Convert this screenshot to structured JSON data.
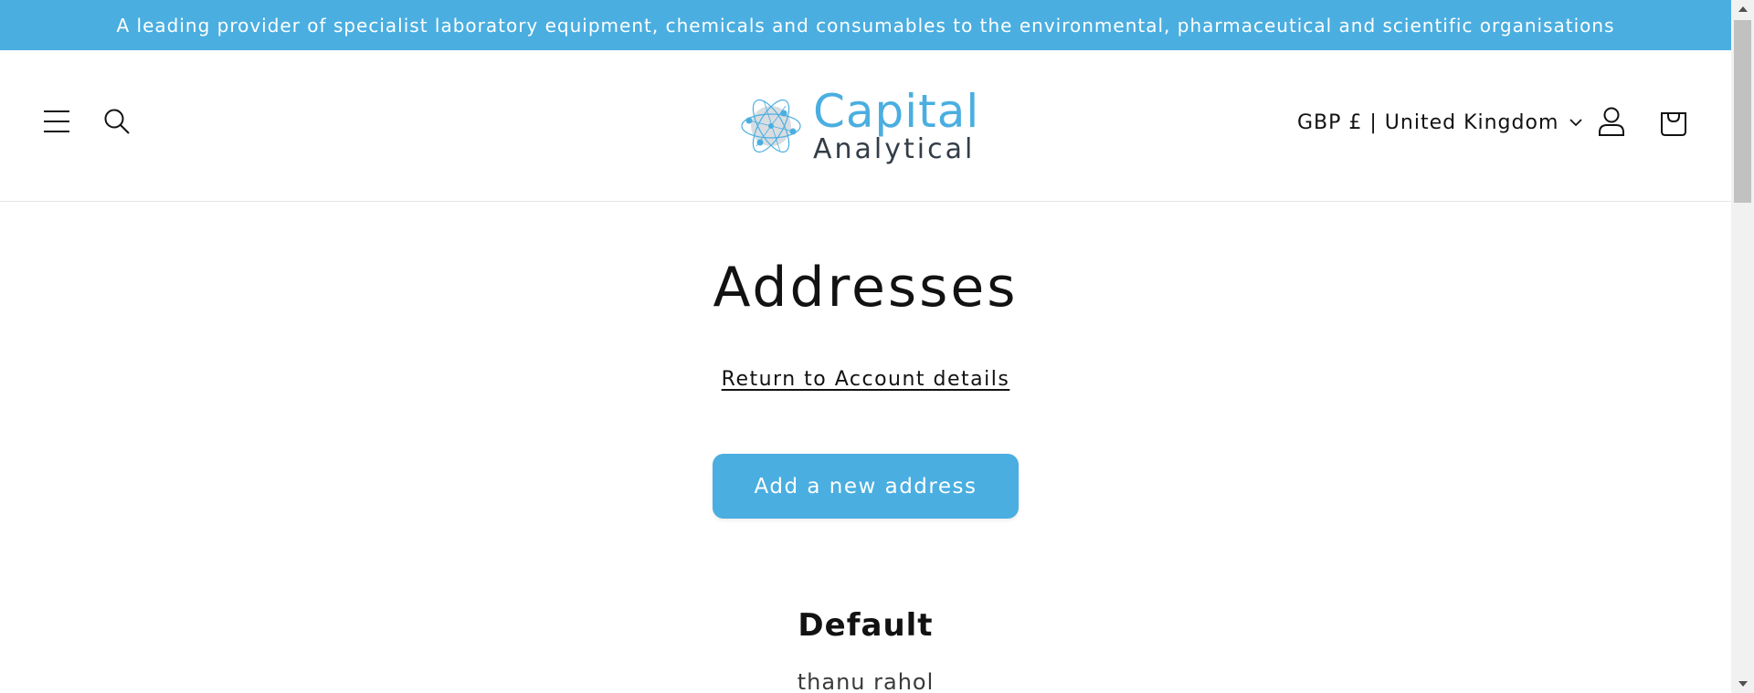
{
  "announcement": {
    "text": "A leading provider of specialist laboratory equipment, chemicals and consumables to the environmental, pharmaceutical and scientific organisations",
    "background": "#4aaee0"
  },
  "header": {
    "logo": {
      "line1": "Capital",
      "line2": "Analytical",
      "accent": "#4aaee0"
    },
    "currency_selector": {
      "label": "GBP £ | United Kingdom"
    },
    "icons": [
      "menu-icon",
      "search-icon",
      "account-icon",
      "cart-icon"
    ]
  },
  "main": {
    "title": "Addresses",
    "return_link": "Return to Account details",
    "add_button": "Add a new address",
    "default_heading": "Default",
    "address_name": "thanu rahol"
  },
  "colors": {
    "brand": "#4aaee0",
    "text": "#121212"
  }
}
